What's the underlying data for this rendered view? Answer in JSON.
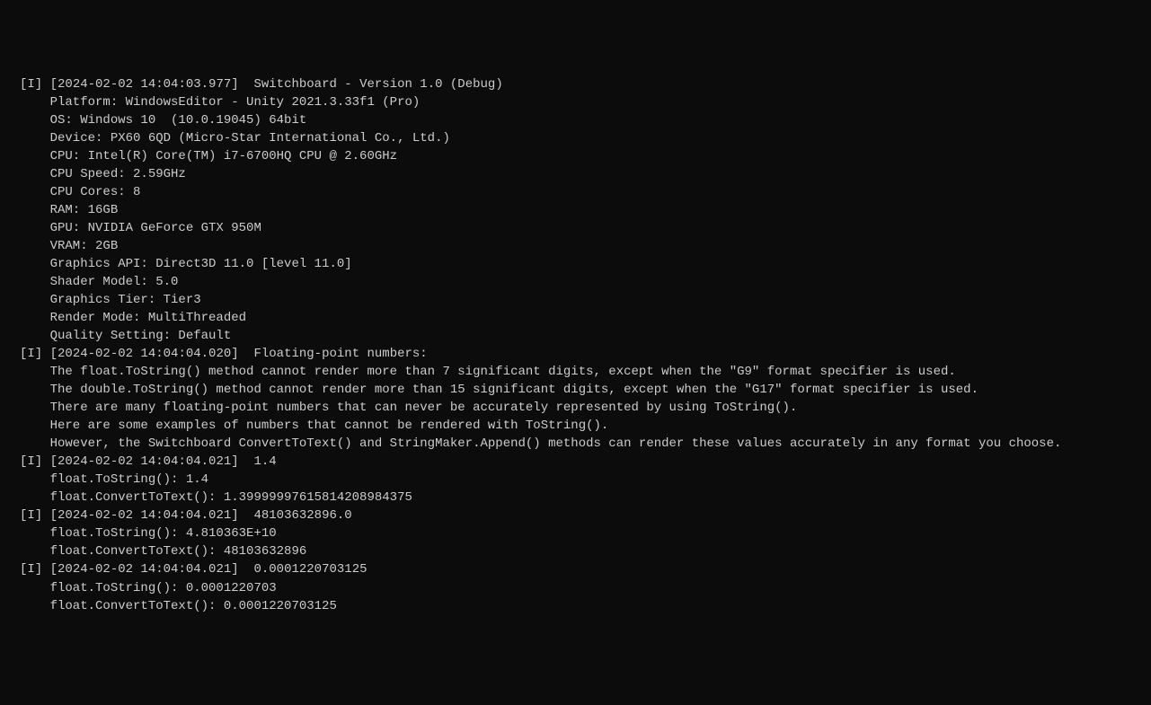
{
  "entries": [
    {
      "tag": "[I]",
      "timestamp": "[2024-02-02 14:04:03.977]",
      "header": "  Switchboard - Version 1.0 (Debug)",
      "lines": [
        "    Platform: WindowsEditor - Unity 2021.3.33f1 (Pro)",
        "    OS: Windows 10  (10.0.19045) 64bit",
        "    Device: PX60 6QD (Micro-Star International Co., Ltd.)",
        "    CPU: Intel(R) Core(TM) i7-6700HQ CPU @ 2.60GHz",
        "    CPU Speed: 2.59GHz",
        "    CPU Cores: 8",
        "    RAM: 16GB",
        "    GPU: NVIDIA GeForce GTX 950M",
        "    VRAM: 2GB",
        "    Graphics API: Direct3D 11.0 [level 11.0]",
        "    Shader Model: 5.0",
        "    Graphics Tier: Tier3",
        "    Render Mode: MultiThreaded",
        "    Quality Setting: Default"
      ]
    },
    {
      "tag": "[I]",
      "timestamp": "[2024-02-02 14:04:04.020]",
      "header": "  Floating-point numbers:",
      "lines": [
        "    The float.ToString() method cannot render more than 7 significant digits, except when the \"G9\" format specifier is used.",
        "    The double.ToString() method cannot render more than 15 significant digits, except when the \"G17\" format specifier is used.",
        "    There are many floating-point numbers that can never be accurately represented by using ToString().",
        "    Here are some examples of numbers that cannot be rendered with ToString().",
        "    However, the Switchboard ConvertToText() and StringMaker.Append() methods can render these values accurately in any format you choose."
      ]
    },
    {
      "tag": "[I]",
      "timestamp": "[2024-02-02 14:04:04.021]",
      "header": "  1.4",
      "lines": [
        "    float.ToString(): 1.4",
        "    float.ConvertToText(): 1.39999997615814208984375"
      ]
    },
    {
      "tag": "[I]",
      "timestamp": "[2024-02-02 14:04:04.021]",
      "header": "  48103632896.0",
      "lines": [
        "    float.ToString(): 4.810363E+10",
        "    float.ConvertToText(): 48103632896"
      ]
    },
    {
      "tag": "[I]",
      "timestamp": "[2024-02-02 14:04:04.021]",
      "header": "  0.0001220703125",
      "lines": [
        "    float.ToString(): 0.0001220703",
        "    float.ConvertToText(): 0.0001220703125"
      ]
    }
  ]
}
